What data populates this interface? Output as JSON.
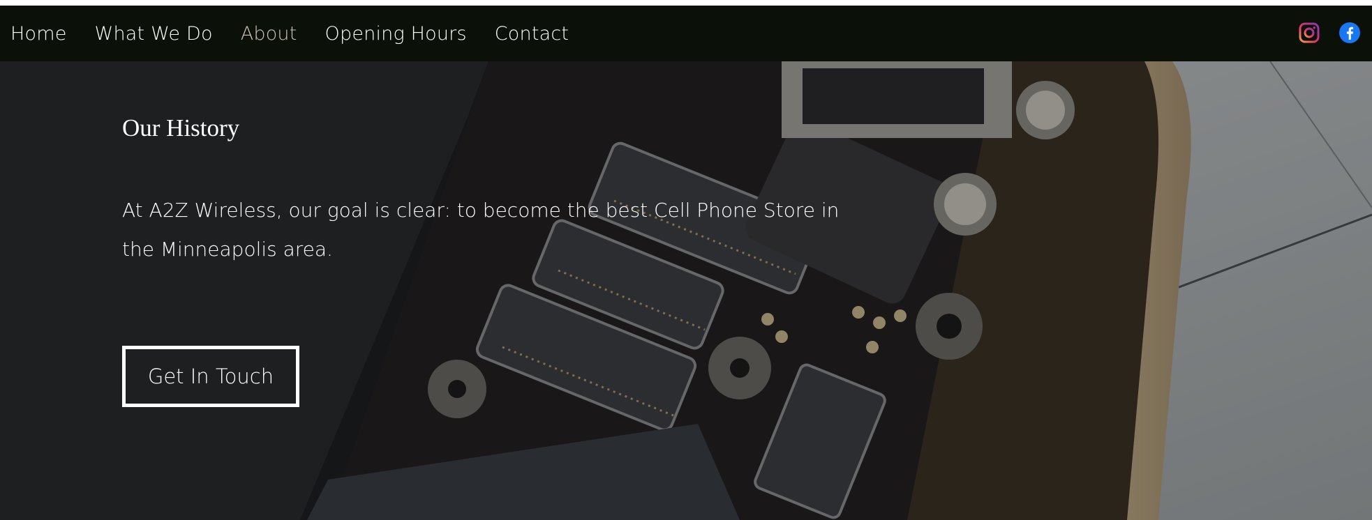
{
  "nav": {
    "items": [
      {
        "label": "Home"
      },
      {
        "label": "What We Do"
      },
      {
        "label": "About"
      },
      {
        "label": "Opening Hours"
      },
      {
        "label": "Contact"
      }
    ],
    "active": "About",
    "social": [
      "instagram-icon",
      "facebook-icon"
    ]
  },
  "hero": {
    "title": "Our History",
    "description": "At A2Z Wireless, our goal is clear: to become the best Cell Phone Store in the Minneapolis area.",
    "cta_label": "Get In Touch"
  },
  "colors": {
    "navbar_bg": "#0b1109",
    "nav_active": "#c9c2b6",
    "text": "#ffffff",
    "facebook": "#1877f2"
  }
}
